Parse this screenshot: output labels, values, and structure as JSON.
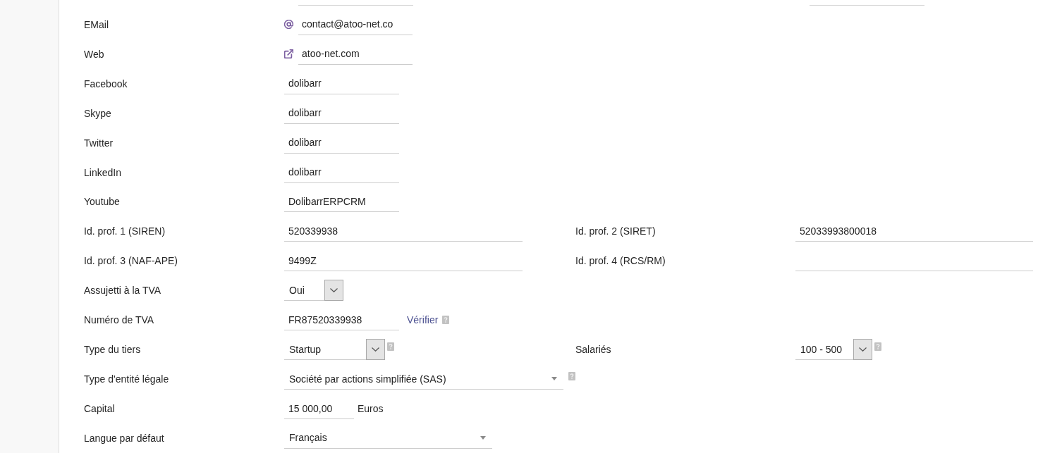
{
  "cut_row": {
    "left_field": true,
    "right_field": true
  },
  "rows": [
    {
      "label": "EMail",
      "field": {
        "kind": "email",
        "value": "contact@atoo-net.co"
      }
    },
    {
      "label": "Web",
      "field": {
        "kind": "url",
        "value": "atoo-net.com"
      }
    },
    {
      "label": "Facebook",
      "field": {
        "kind": "text",
        "value": "dolibarr"
      }
    },
    {
      "label": "Skype",
      "field": {
        "kind": "text",
        "value": "dolibarr"
      }
    },
    {
      "label": "Twitter",
      "field": {
        "kind": "text",
        "value": "dolibarr"
      }
    },
    {
      "label": "LinkedIn",
      "field": {
        "kind": "text",
        "value": "dolibarr"
      }
    },
    {
      "label": "Youtube",
      "field": {
        "kind": "text",
        "value": "DolibarrERPCRM"
      }
    },
    {
      "label": "Id. prof. 1 (SIREN)",
      "field": {
        "kind": "text",
        "value": "520339938"
      },
      "right": {
        "label": "Id. prof. 2 (SIRET)",
        "field": {
          "kind": "text",
          "value": "52033993800018"
        }
      }
    },
    {
      "label": "Id. prof. 3 (NAF-APE)",
      "field": {
        "kind": "text",
        "value": "9499Z"
      },
      "right": {
        "label": "Id. prof. 4 (RCS/RM)",
        "field": {
          "kind": "text"
        }
      }
    },
    {
      "label": "Assujetti à la TVA",
      "field": {
        "kind": "select",
        "value": "Oui"
      }
    },
    {
      "label": "Numéro de TVA",
      "field": {
        "kind": "text",
        "value": "FR87520339938",
        "link": "Vérifier",
        "help": true
      }
    },
    {
      "label": "Type du tiers",
      "field": {
        "kind": "select",
        "value": "Startup",
        "help": true
      },
      "right": {
        "label": "Salariés",
        "field": {
          "kind": "select",
          "value": "100 - 500",
          "help": true
        }
      }
    },
    {
      "label": "Type d'entité légale",
      "field": {
        "kind": "combo",
        "value": "Société par actions simplifiée (SAS)",
        "help": true
      }
    },
    {
      "label": "Capital",
      "field": {
        "kind": "text",
        "value": "15 000,00",
        "unit": "Euros"
      }
    },
    {
      "label": "Langue par défaut",
      "field": {
        "kind": "combo",
        "value": "Français"
      }
    }
  ]
}
